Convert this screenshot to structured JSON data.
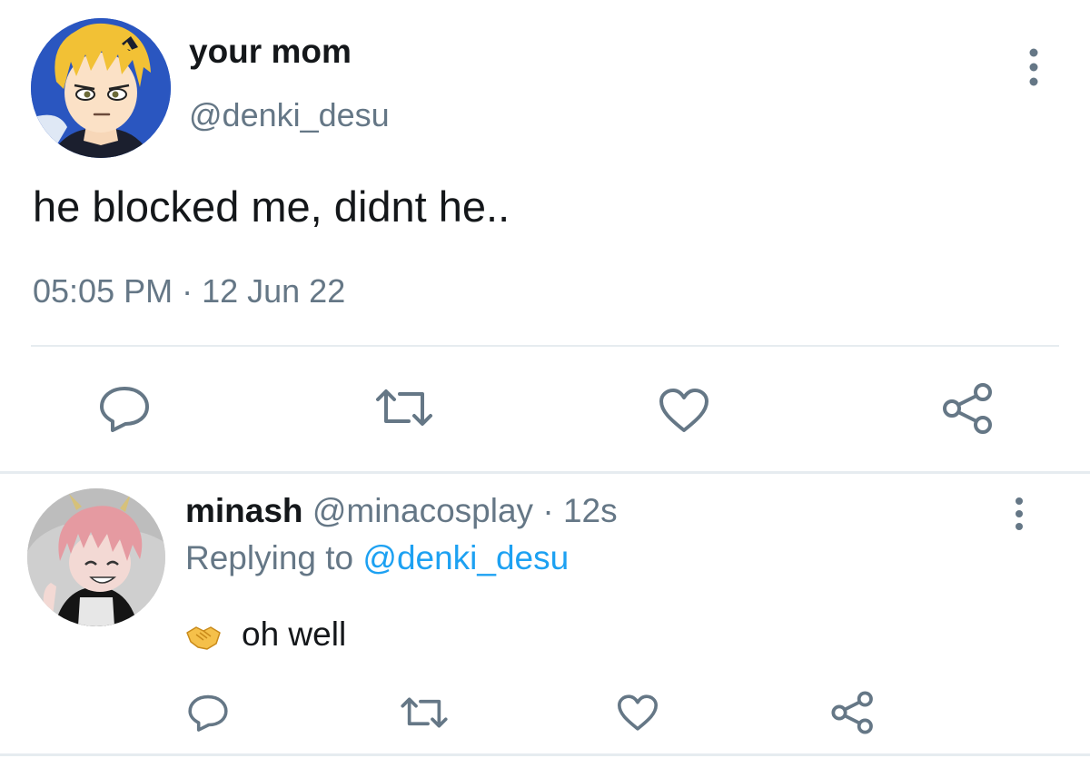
{
  "main_tweet": {
    "display_name": "your mom",
    "handle": "@denki_desu",
    "text": "he blocked me, didnt he..",
    "timestamp": "05:05 PM · 12 Jun 22",
    "avatar_icon": "anime-boy-blonde-avatar",
    "actions": [
      "reply-icon",
      "retweet-icon",
      "like-icon",
      "share-icon"
    ]
  },
  "reply_tweet": {
    "display_name": "minash",
    "handle": "@minacosplay",
    "separator": "·",
    "time": "12s",
    "replying_prefix": "Replying to",
    "replying_to": "@denki_desu",
    "emoji": "handshake-emoji",
    "text": "oh well",
    "avatar_icon": "anime-girl-pink-hair-avatar",
    "actions": [
      "reply-icon",
      "retweet-icon",
      "like-icon",
      "share-icon"
    ]
  },
  "colors": {
    "text_primary": "#14171a",
    "text_secondary": "#657786",
    "link": "#1da1f2",
    "divider": "#e6ecf0"
  }
}
